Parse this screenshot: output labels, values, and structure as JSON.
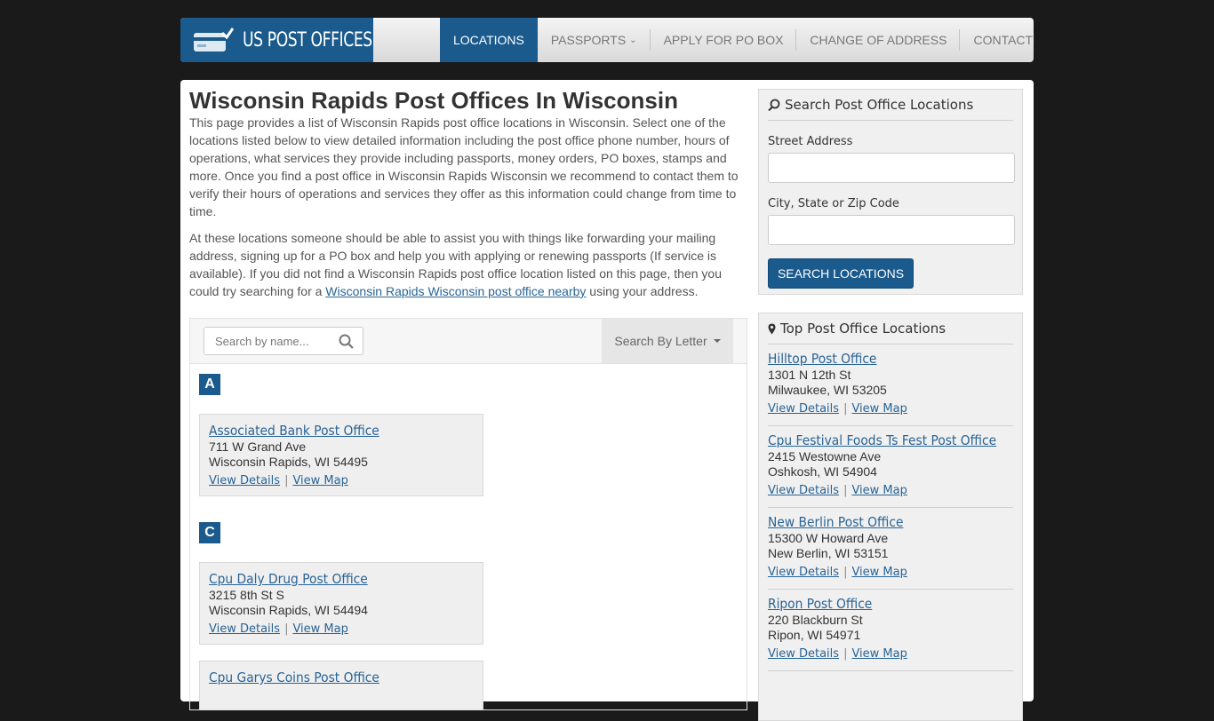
{
  "header": {
    "logo": {
      "text_a": "US POST ",
      "text_b": "OFFICES"
    },
    "nav": [
      {
        "label": "LOCATIONS",
        "active": true
      },
      {
        "label": "PASSPORTS",
        "dropdown": true
      },
      {
        "label": "APPLY FOR PO BOX"
      },
      {
        "label": "CHANGE OF ADDRESS"
      },
      {
        "label": "CONTACT US"
      }
    ]
  },
  "main": {
    "title": "Wisconsin Rapids Post Offices In Wisconsin",
    "para1": "This page provides a list of Wisconsin Rapids post office locations in Wisconsin. Select one of the locations listed below to view detailed information including the post office phone number, hours of operations, what services they provide including passports, money orders, PO boxes, stamps and more. Once you find a post office in Wisconsin Rapids Wisconsin we recommend to contact them to verify their hours of operations and services they offer as this information could change from time to time.",
    "para2_before": "At these locations someone should be able to assist you with things like forwarding your mailing address, signing up for a PO box and help you with applying or renewing passports (If service is available). If you did not find a Wisconsin Rapids post office location listed on this page, then you could try searching for a ",
    "para2_link": "Wisconsin Rapids Wisconsin post office nearby",
    "para2_after": " using your address.",
    "search_placeholder": "Search by name...",
    "letter_button": "Search By Letter",
    "groups": [
      {
        "letter": "A",
        "offices": [
          {
            "name": "Associated Bank Post Office",
            "street": "711 W Grand Ave",
            "city": "Wisconsin Rapids, WI 54495"
          }
        ]
      },
      {
        "letter": "C",
        "offices": [
          {
            "name": "Cpu Daly Drug Post Office",
            "street": "3215 8th St S",
            "city": "Wisconsin Rapids, WI 54494"
          },
          {
            "name": "Cpu Garys Coins Post Office",
            "street": "",
            "city": ""
          }
        ]
      }
    ],
    "details_label": "View Details",
    "map_label": "View Map"
  },
  "sidebar": {
    "search": {
      "heading": "Search Post Office Locations",
      "street_label": "Street Address",
      "city_label": "City, State or Zip Code",
      "button": "SEARCH LOCATIONS"
    },
    "top": {
      "heading": "Top Post Office Locations",
      "items": [
        {
          "name": "Hilltop Post Office",
          "street": "1301 N 12th St",
          "city": "Milwaukee, WI 53205"
        },
        {
          "name": "Cpu Festival Foods Ts Fest Post Office",
          "street": "2415 Westowne Ave",
          "city": "Oshkosh, WI 54904"
        },
        {
          "name": "New Berlin Post Office",
          "street": "15300 W Howard Ave",
          "city": "New Berlin, WI 53151"
        },
        {
          "name": "Ripon Post Office",
          "street": "220 Blackburn St",
          "city": "Ripon, WI 54971"
        }
      ]
    }
  },
  "colors": {
    "brand": "#1a5a8c",
    "link": "#2a6496",
    "page_bg": "#1a1a1a"
  }
}
